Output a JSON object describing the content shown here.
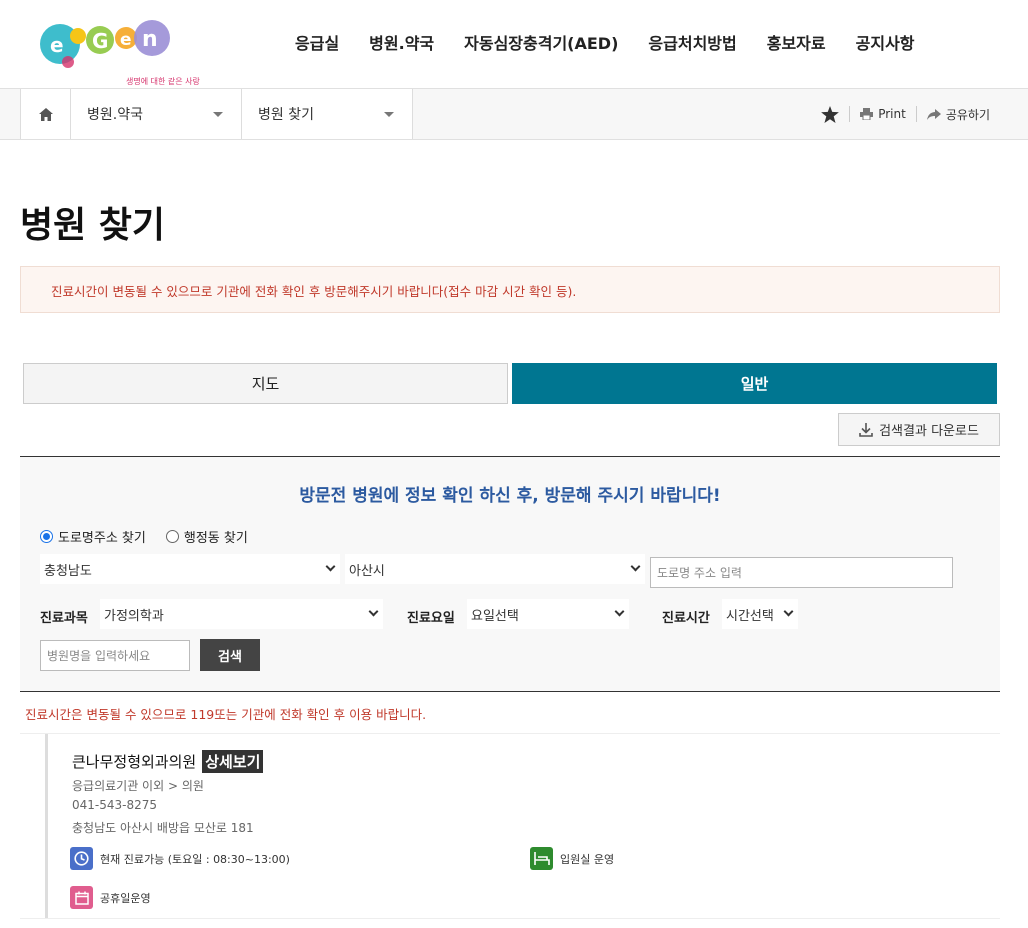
{
  "header": {
    "logo_tagline": "생명에 대한 같은 사랑",
    "nav": [
      "응급실",
      "병원.약국",
      "자동심장충격기(AED)",
      "응급처치방법",
      "홍보자료",
      "공지사항"
    ]
  },
  "breadcrumb": {
    "level1": "병원.약국",
    "level2": "병원 찾기",
    "print_label": "Print",
    "share_label": "공유하기"
  },
  "page": {
    "title": "병원 찾기",
    "notice": "진료시간이 변동될 수 있으므로 기관에 전화 확인 후 방문해주시기 바랍니다(접수 마감 시간 확인 등)."
  },
  "tabs": {
    "map": "지도",
    "general": "일반"
  },
  "download_label": "검색결과 다운로드",
  "search": {
    "title": "방문전 병원에 정보 확인 하신 후, 방문해 주시기 바랍니다!",
    "radio_road": "도로명주소 찾기",
    "radio_admin": "행정동 찾기",
    "province": "충청남도",
    "city": "아산시",
    "road_placeholder": "도로명 주소 입력",
    "dept_label": "진료과목",
    "dept_value": "가정의학과",
    "day_label": "진료요일",
    "day_value": "요일선택",
    "time_label": "진료시간",
    "time_value": "시간선택",
    "name_placeholder": "병원명을 입력하세요",
    "search_button": "검색"
  },
  "warning": "진료시간은 변동될 수 있으므로 119또는 기관에 전화 확인 후 이용 바랍니다.",
  "results": [
    {
      "name": "큰나무정형외과의원",
      "detail_label": "상세보기",
      "category": "응급의료기관 이외 > 의원",
      "phone": "041-543-8275",
      "address": "충청남도 아산시 배방읍 모산로 181",
      "hours": "현재 진료가능 (토요일 : 08:30~13:00)",
      "inpatient": "입원실 운영",
      "holiday": "공휴일운영"
    }
  ],
  "colors": {
    "tab_active": "#007691",
    "panel_title": "#2c5aa0",
    "notice_text": "#c0392b",
    "clock_icon": "#4a6fc9",
    "bed_icon": "#2e8b2e",
    "calendar_icon": "#e05d8e"
  }
}
